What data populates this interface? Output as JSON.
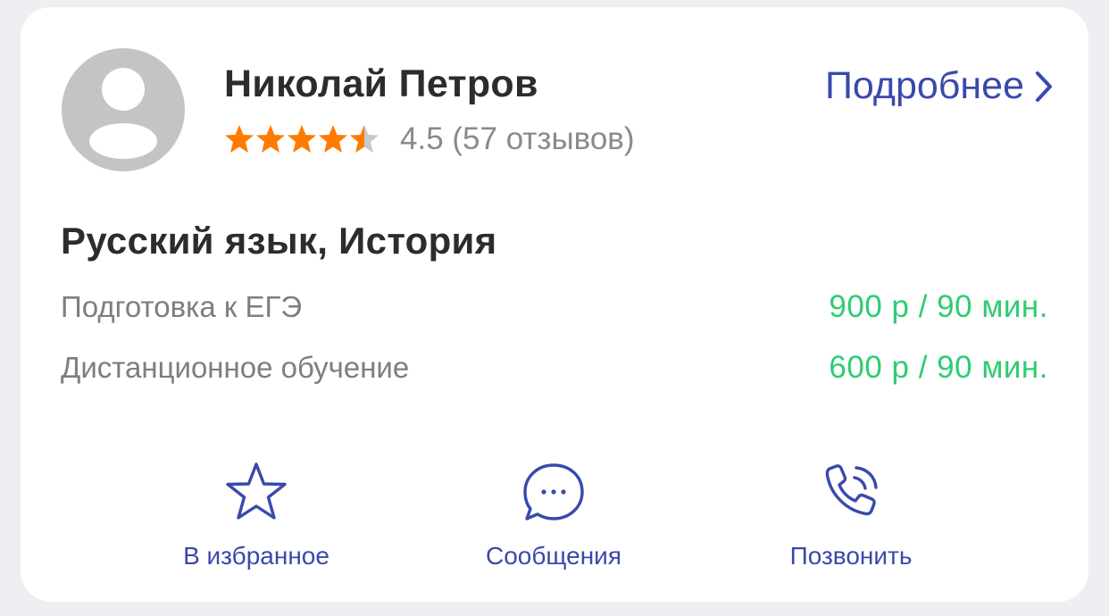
{
  "profile": {
    "name": "Николай Петров",
    "rating_value": 4.5,
    "rating_max": 5,
    "rating_text": "4.5 (57 отзывов)",
    "details_link": "Подробнее",
    "avatar_icon": "person-placeholder-icon"
  },
  "subjects": "Русский язык, История",
  "services": [
    {
      "name": "Подготовка к ЕГЭ",
      "price": "900 р / 90 мин."
    },
    {
      "name": "Дистанционное обучение",
      "price": "600 р / 90 мин."
    }
  ],
  "actions": {
    "favorite": {
      "label": "В избранное",
      "icon": "star-outline-icon"
    },
    "messages": {
      "label": "Сообщения",
      "icon": "chat-bubble-icon"
    },
    "call": {
      "label": "Позвонить",
      "icon": "phone-ringing-icon"
    }
  },
  "colors": {
    "accent": "#3949ab",
    "price": "#2ecc71",
    "star": "#ff7a00",
    "star_empty": "#c7c7cc",
    "avatar_bg": "#c4c4c6"
  }
}
